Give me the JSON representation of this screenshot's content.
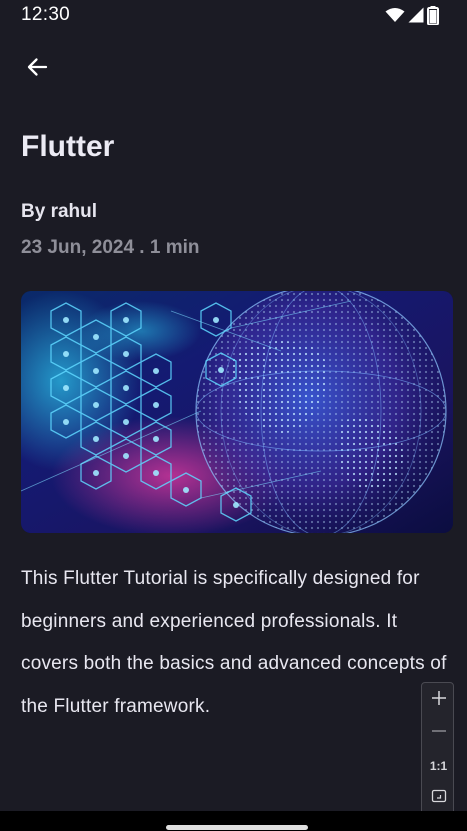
{
  "status_bar": {
    "time": "12:30",
    "icons": [
      "wifi-icon",
      "signal-icon",
      "battery-icon"
    ]
  },
  "nav": {
    "back_icon": "arrow-left-icon"
  },
  "article": {
    "title": "Flutter",
    "author": "By rahul",
    "meta": "23 Jun, 2024 . 1 min",
    "body": "This Flutter Tutorial is specifically designed for beginners and experienced professionals. It covers both the basics and advanced concepts of the Flutter framework."
  },
  "zoom_controls": {
    "zoom_in_icon": "plus-icon",
    "zoom_out_icon": "minus-icon",
    "reset_label": "1:1",
    "fit_icon": "fit-screen-icon"
  },
  "colors": {
    "background": "#1b1b24",
    "text_primary": "#ecebf4",
    "text_secondary": "#8f8f99",
    "image_accent_cyan": "#22d3ff",
    "image_accent_magenta": "#c0308a"
  }
}
